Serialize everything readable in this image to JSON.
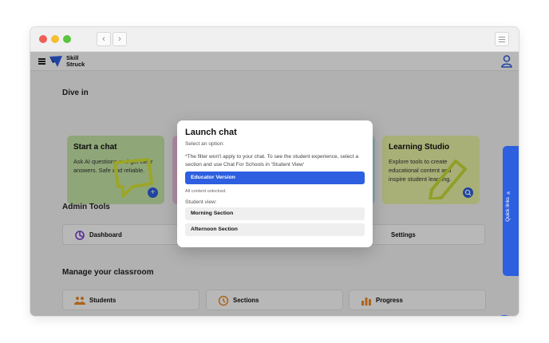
{
  "browser": {
    "back_glyph": "‹",
    "forward_glyph": "›"
  },
  "header": {
    "logo_line1": "Skill",
    "logo_line2": "Struck",
    "menu_icon": "hamburger-icon",
    "user_icon": "user-icon"
  },
  "dive_in": {
    "title": "Dive in",
    "cards": [
      {
        "title": "Start a chat",
        "desc": "Ask AI questions and get clear answers. Safe and reliable.",
        "color": "#c7e7a8",
        "fab": "+"
      },
      {
        "title": "",
        "desc": "",
        "color": "#f2c6e6"
      },
      {
        "title": "",
        "desc": "",
        "color": "#bfe6e6"
      },
      {
        "title": "Learning Studio",
        "desc": "Explore tools to create educational content and inspire student learning.",
        "color": "#e9f4a6",
        "fab": "search"
      }
    ]
  },
  "admin_tools": {
    "title": "Admin Tools",
    "items": [
      {
        "label": "Dashboard",
        "icon": "dashboard-icon"
      },
      {
        "label": "Settings",
        "icon": "settings-icon"
      }
    ]
  },
  "manage": {
    "title": "Manage your classroom",
    "items": [
      {
        "label": "Students",
        "icon": "students-icon"
      },
      {
        "label": "Sections",
        "icon": "clock-icon"
      },
      {
        "label": "Progress",
        "icon": "bar-chart-icon"
      }
    ]
  },
  "quick_links": {
    "label": "Quick links",
    "chevron": "«"
  },
  "modal": {
    "title": "Launch chat",
    "subtitle": "Select an option:",
    "note": "*The filter won't apply to your chat. To see the student experience, select a section and use Chat For Schools in 'Student View'",
    "primary_option": "Educator Version",
    "unlocked_text": "All content unlocked.",
    "student_view_label": "Student view:",
    "options": [
      "Morning Section",
      "Afternoon Section"
    ]
  },
  "colors": {
    "accent": "#2d5fe0",
    "overlay": "rgba(0,0,0,0.28)"
  }
}
